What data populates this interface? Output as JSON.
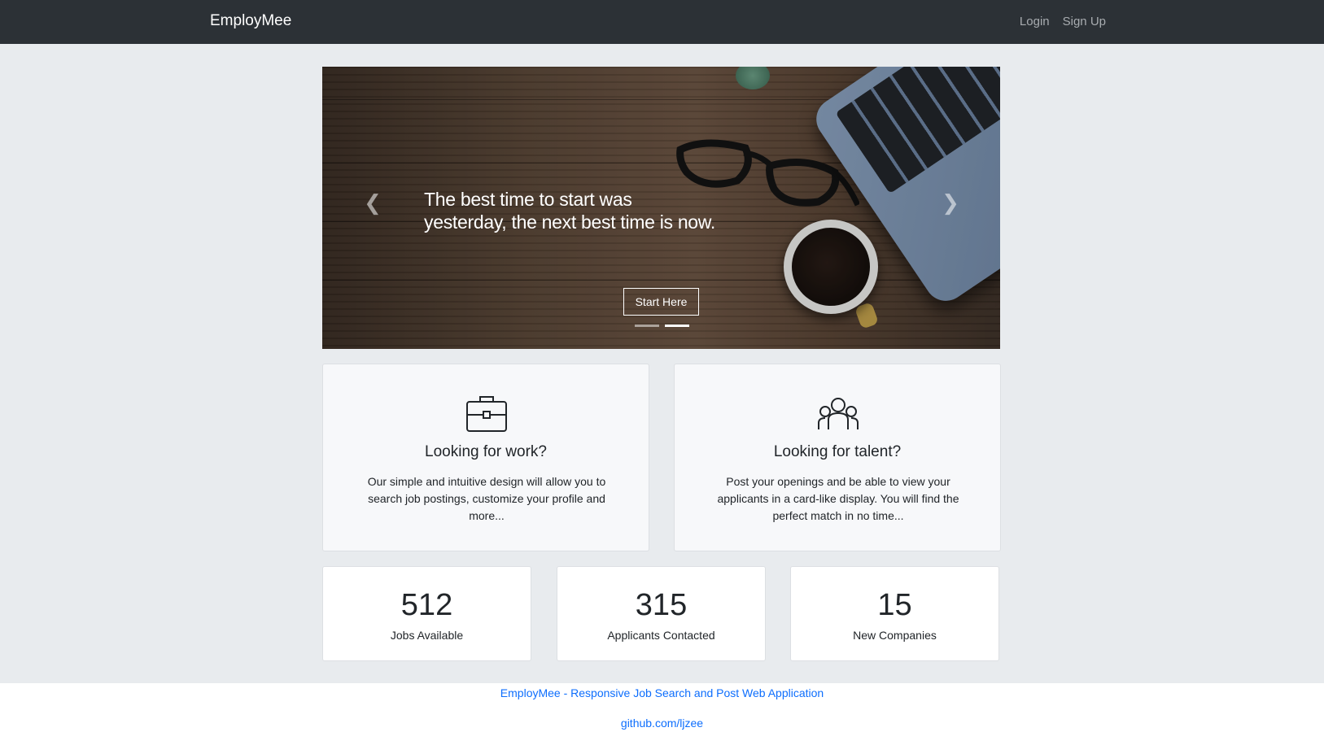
{
  "navbar": {
    "brand": "EmployMee",
    "links": [
      "Login",
      "Sign Up"
    ]
  },
  "hero": {
    "headline": "The best time to start was yesterday, the next best time is now.",
    "button_label": "Start Here",
    "prev_glyph": "❮",
    "next_glyph": "❯",
    "slides": 2,
    "active_slide": 2
  },
  "features": [
    {
      "icon": "briefcase-icon",
      "title": "Looking for work?",
      "text": "Our simple and intuitive design will allow you to search job postings, customize your profile and more..."
    },
    {
      "icon": "people-icon",
      "title": "Looking for talent?",
      "text": "Post your openings and be able to view your applicants in a card-like display. You will find the perfect match in no time..."
    }
  ],
  "stats": [
    {
      "value": "512",
      "label": "Jobs Available"
    },
    {
      "value": "315",
      "label": "Applicants Contacted"
    },
    {
      "value": "15",
      "label": "New Companies"
    }
  ],
  "footer": {
    "title_link": "EmployMee - Responsive Job Search and Post Web Application",
    "github_link": "github.com/ljzee"
  },
  "colors": {
    "navbar_bg": "#2c3136",
    "page_bg": "#e8ebee",
    "link_blue": "#0d6efd"
  }
}
